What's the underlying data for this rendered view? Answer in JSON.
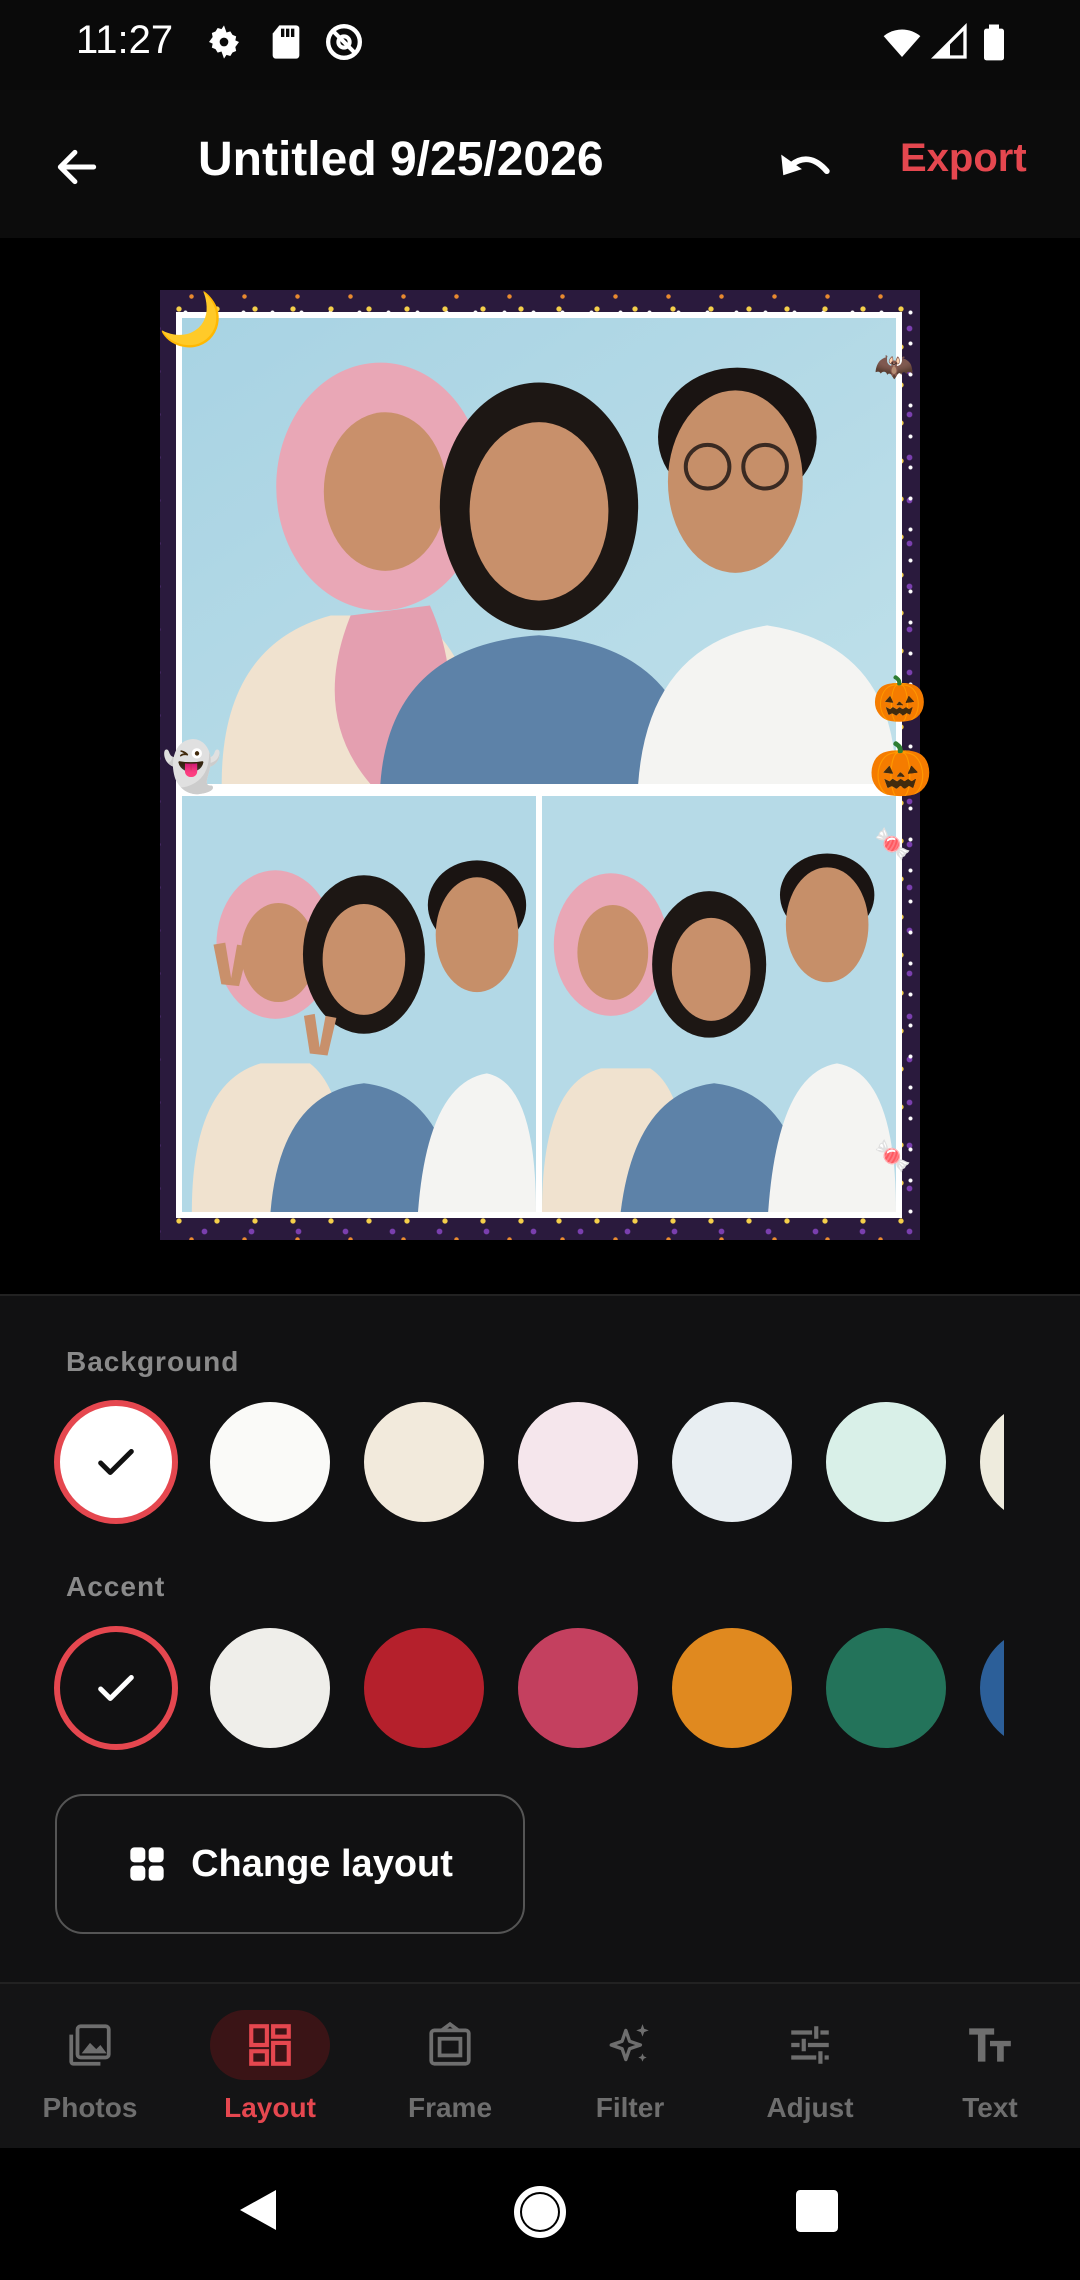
{
  "status_bar": {
    "time": "11:27",
    "icons": [
      "gear-icon",
      "sd-card-icon",
      "at-sign-icon",
      "wifi-icon",
      "signal-icon",
      "battery-icon"
    ]
  },
  "app_bar": {
    "title": "Untitled 9/25/2026",
    "export_label": "Export",
    "icons": [
      "arrow-back-icon",
      "undo-icon"
    ]
  },
  "collage": {
    "layout": "1 large top + 2 bottom",
    "frame_theme": "halloween",
    "stickers": [
      "🌙",
      "🦇",
      "🎃",
      "🎃",
      "👻",
      "🍬",
      "🍬"
    ]
  },
  "background": {
    "label": "Background",
    "selected_index": 0,
    "swatches": [
      "#ffffff",
      "#fafaf8",
      "#f2eadc",
      "#f5e6ec",
      "#e8eef2",
      "#d9f0e8",
      "#eeebdd"
    ]
  },
  "accent": {
    "label": "Accent",
    "selected_index": 0,
    "swatches": [
      "#111112",
      "#efeeea",
      "#b5202c",
      "#c4405f",
      "#e0891f",
      "#23735a",
      "#2c5f99"
    ]
  },
  "change_layout": {
    "label": "Change layout"
  },
  "nav": {
    "active": "Layout",
    "items": [
      {
        "label": "Photos",
        "icon": "photos-icon"
      },
      {
        "label": "Layout",
        "icon": "layout-icon"
      },
      {
        "label": "Frame",
        "icon": "frame-icon"
      },
      {
        "label": "Filter",
        "icon": "sparkle-icon"
      },
      {
        "label": "Adjust",
        "icon": "sliders-icon"
      },
      {
        "label": "Text",
        "icon": "text-icon"
      }
    ]
  },
  "colors": {
    "accent": "#e5474f",
    "panel": "#111112"
  }
}
